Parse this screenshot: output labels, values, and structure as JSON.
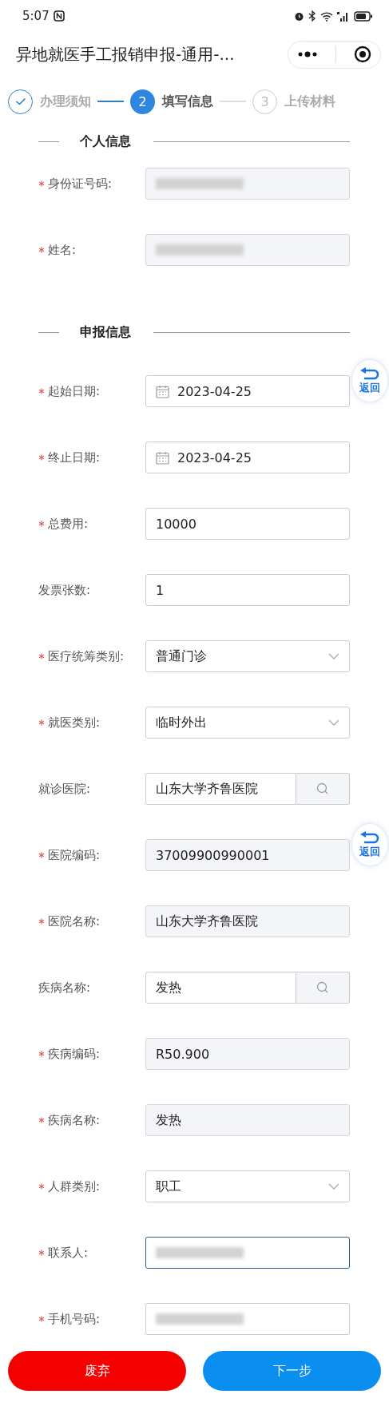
{
  "status_bar": {
    "time": "5:07"
  },
  "title": "异地就医手工报销申报-通用-...",
  "steps": [
    {
      "label": "办理须知",
      "done": true,
      "selected": false
    },
    {
      "number": "2",
      "label": "填写信息",
      "done": false,
      "selected": true
    },
    {
      "number": "3",
      "label": "上传材料",
      "done": false,
      "selected": false
    }
  ],
  "sections": [
    {
      "title": "个人信息",
      "fields": [
        {
          "label": "身份证号码:",
          "required": true,
          "kind": "readonly",
          "redacted": true
        },
        {
          "label": "姓名:",
          "required": true,
          "kind": "readonly",
          "redacted": true
        }
      ]
    },
    {
      "title": "申报信息",
      "fields": [
        {
          "label": "起始日期:",
          "required": true,
          "kind": "date",
          "value": "2023-04-25",
          "float_button": "返回"
        },
        {
          "label": "终止日期:",
          "required": true,
          "kind": "date",
          "value": "2023-04-25"
        },
        {
          "label": "总费用:",
          "required": true,
          "kind": "input",
          "value": "10000"
        },
        {
          "label": "发票张数:",
          "required": false,
          "kind": "input",
          "value": "1"
        },
        {
          "label": "医疗统筹类别:",
          "required": true,
          "kind": "select",
          "value": "普通门诊"
        },
        {
          "label": "就医类别:",
          "required": true,
          "kind": "select",
          "value": "临时外出"
        },
        {
          "label": "就诊医院:",
          "required": false,
          "kind": "search",
          "value": "山东大学齐鲁医院"
        },
        {
          "label": "医院编码:",
          "required": true,
          "kind": "readonly",
          "value": "37009900990001",
          "float_button": "返回"
        },
        {
          "label": "医院名称:",
          "required": true,
          "kind": "readonly",
          "value": "山东大学齐鲁医院"
        },
        {
          "label": "疾病名称:",
          "required": false,
          "kind": "search",
          "value": "发热"
        },
        {
          "label": "疾病编码:",
          "required": true,
          "kind": "readonly",
          "value": "R50.900"
        },
        {
          "label": "疾病名称:",
          "required": true,
          "kind": "readonly",
          "value": "发热"
        },
        {
          "label": "人群类别:",
          "required": true,
          "kind": "select",
          "value": "职工"
        },
        {
          "label": "联系人:",
          "required": true,
          "kind": "input",
          "focused": true,
          "redacted": true
        },
        {
          "label": "手机号码:",
          "required": true,
          "kind": "input",
          "redacted": true
        }
      ]
    }
  ],
  "buttons": [
    {
      "label": "废弃",
      "kind": "danger"
    },
    {
      "label": "下一步",
      "kind": "primary"
    }
  ]
}
